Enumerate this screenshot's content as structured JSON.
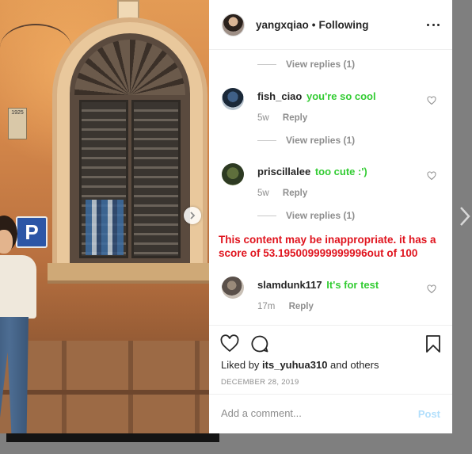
{
  "post": {
    "owner_username": "yangxqiao",
    "separator": "•",
    "follow_status": "Following"
  },
  "photo": {
    "sign_plate_text": "1925",
    "parking_sign": "P"
  },
  "comments": [
    {
      "replies_label": "View replies (1)"
    },
    {
      "username": "fish_ciao",
      "text": "you're so cool",
      "age": "5w",
      "reply_label": "Reply",
      "replies_label": "View replies (1)"
    },
    {
      "username": "priscillalee",
      "text": "too cute :')",
      "age": "5w",
      "reply_label": "Reply",
      "replies_label": "View replies (1)"
    },
    {
      "username": "slamdunk117",
      "text": "It's for test",
      "age": "17m",
      "reply_label": "Reply"
    }
  ],
  "warning": "This content may be inappropriate. it has a score of 53.195009999999996out of 100",
  "likes": {
    "prefix": "Liked by",
    "user": "its_yuhua310",
    "suffix": "and others"
  },
  "date": "DECEMBER 28, 2019",
  "add_comment": {
    "placeholder": "Add a comment...",
    "post_label": "Post"
  },
  "colors": {
    "comment_text": "#33cc33",
    "warning": "#e0141e",
    "post_button_disabled": "#b2dffc"
  },
  "icons": [
    "more-icon",
    "chevron-right-icon",
    "heart-icon",
    "comment-icon",
    "bookmark-icon"
  ]
}
